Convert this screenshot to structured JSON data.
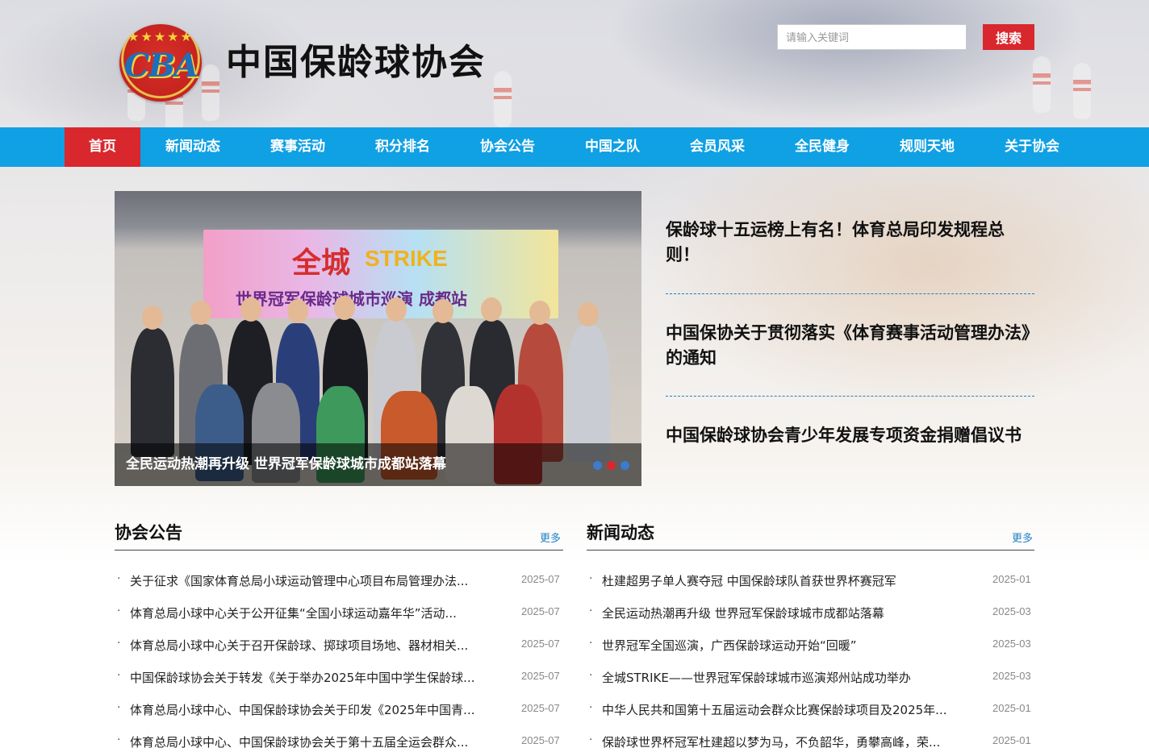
{
  "site": {
    "logo_title": "中国保龄球协会"
  },
  "search": {
    "placeholder": "请输入关键词",
    "button_label": "搜索"
  },
  "nav": {
    "items": [
      {
        "label": "首页",
        "active": true
      },
      {
        "label": "新闻动态"
      },
      {
        "label": "赛事活动"
      },
      {
        "label": "积分排名"
      },
      {
        "label": "协会公告"
      },
      {
        "label": "中国之队"
      },
      {
        "label": "会员风采"
      },
      {
        "label": "全民健身"
      },
      {
        "label": "规则天地"
      },
      {
        "label": "关于协会"
      }
    ]
  },
  "slider": {
    "banner_text_1": "全城",
    "banner_text_2": "STRIKE",
    "banner_text_3": "世界冠军保龄球城市巡演 成都站",
    "caption": "全民运动热潮再升级 世界冠军保龄球城市成都站落幕",
    "dot_colors": [
      "#3b7bd0",
      "#d9272e",
      "#3b7bd0"
    ]
  },
  "headlines": [
    "保龄球十五运榜上有名！体育总局印发规程总则！",
    "中国保协关于贯彻落实《体育赛事活动管理办法》的通知",
    "中国保龄球协会青少年发展专项资金捐赠倡议书"
  ],
  "announcements": {
    "title": "协会公告",
    "more": "更多",
    "items": [
      {
        "title": "关于征求《国家体育总局小球运动管理中心项目布局管理办法...",
        "date": "2025-07"
      },
      {
        "title": "体育总局小球中心关于公开征集“全国小球运动嘉年华”活动...",
        "date": "2025-07"
      },
      {
        "title": "体育总局小球中心关于召开保龄球、掷球项目场地、器材相关...",
        "date": "2025-07"
      },
      {
        "title": "中国保龄球协会关于转发《关于举办2025年中国中学生保龄球...",
        "date": "2025-07"
      },
      {
        "title": "体育总局小球中心、中国保龄球协会关于印发《2025年中国青...",
        "date": "2025-07"
      },
      {
        "title": "体育总局小球中心、中国保龄球协会关于第十五届全运会群众...",
        "date": "2025-07"
      }
    ]
  },
  "news": {
    "title": "新闻动态",
    "more": "更多",
    "items": [
      {
        "title": "杜建超男子单人赛夺冠 中国保龄球队首获世界杯赛冠军",
        "date": "2025-01"
      },
      {
        "title": "全民运动热潮再升级 世界冠军保龄球城市成都站落幕",
        "date": "2025-03"
      },
      {
        "title": "世界冠军全国巡演，广西保龄球运动开始“回暖”",
        "date": "2025-03"
      },
      {
        "title": "全城STRIKE——世界冠军保龄球城市巡演郑州站成功举办",
        "date": "2025-03"
      },
      {
        "title": "中华人民共和国第十五届运动会群众比赛保龄球项目及2025年...",
        "date": "2025-01"
      },
      {
        "title": "保龄球世界杯冠军杜建超以梦为马，不负韶华，勇攀高峰，荣...",
        "date": "2025-01"
      }
    ]
  },
  "colors": {
    "nav_bg": "#10a0e4",
    "accent_red": "#d9272e",
    "link_blue": "#1f7fc4"
  }
}
